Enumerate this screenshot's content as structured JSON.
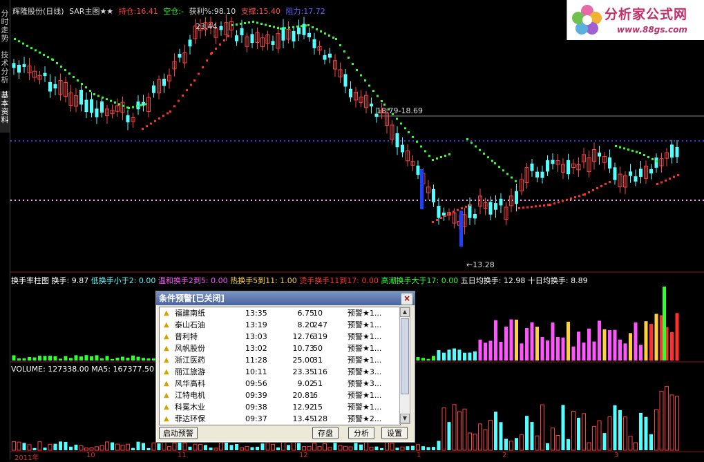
{
  "side_tabs": [
    "分时走势",
    "技术分析",
    "基本资料"
  ],
  "header": {
    "stock": "辉隆股份(日线)",
    "indicator": "SAR主图★★",
    "hold_label": "持仓:",
    "hold_val": "16.41",
    "empty_label": "空仓:",
    "empty_val": "-",
    "profit_label": "获利%:",
    "profit_val": "98.10",
    "support_label": "支撑:",
    "support_val": "15.40",
    "resist_label": "阻力:",
    "resist_val": "17.72"
  },
  "annotations": {
    "high": "23.44",
    "range": "18.79-18.69",
    "low": "←13.28"
  },
  "turnover_header": {
    "name": "换手率柱图",
    "hs": "换手: 9.87",
    "low": "低换手小于2: 0.00",
    "mild": "温和换手2到5: 0.00",
    "hot": "热换手5到11: 1.00",
    "frenzy": "烫手换手11到17: 0.00",
    "high": "高潮换手大于17: 0.00",
    "ma5": "五日均换手: 12.98",
    "ma10": "十日均换手: 8.89"
  },
  "volume_header": "VOLUME: 127338.00  MA5: 167377.50",
  "dates": [
    "2011年",
    "10",
    "11",
    "12",
    "1",
    "2",
    "3"
  ],
  "logo": {
    "title": "分析家公式网",
    "url": "www.88gs.com"
  },
  "dialog": {
    "title": "条件预警[已关闭]",
    "rows": [
      {
        "name": "福建南纸",
        "time": "13:35",
        "price": "6.75",
        "qty": "10",
        "status": "预警★1..."
      },
      {
        "name": "泰山石油",
        "time": "13:19",
        "price": "8.20",
        "qty": "247",
        "status": "预警★1..."
      },
      {
        "name": "普利特",
        "time": "13:03",
        "price": "12.76",
        "qty": "319",
        "status": "预警★1..."
      },
      {
        "name": "风帆股份",
        "time": "13:02",
        "price": "10.73",
        "qty": "50",
        "status": "预警★1..."
      },
      {
        "name": "浙江医药",
        "time": "11:28",
        "price": "25.00",
        "qty": "31",
        "status": "预警★1..."
      },
      {
        "name": "丽江旅游",
        "time": "10:11",
        "price": "23.35",
        "qty": "116",
        "status": "预警★3..."
      },
      {
        "name": "风华高科",
        "time": "09:56",
        "price": "9.02",
        "qty": "51",
        "status": "预警★3..."
      },
      {
        "name": "江特电机",
        "time": "09:39",
        "price": "20.81",
        "qty": "6",
        "status": "预警★1..."
      },
      {
        "name": "科冕木业",
        "time": "09:38",
        "price": "12.92",
        "qty": "15",
        "status": "预警★1..."
      },
      {
        "name": "菲达环保",
        "time": "09:37",
        "price": "13.45",
        "qty": "128",
        "status": "预警★2..."
      }
    ],
    "buttons": {
      "start": "启动预警",
      "save": "存盘",
      "analyze": "分析",
      "settings": "设置"
    }
  },
  "colors": {
    "up": "#ff4040",
    "down": "#54ffff",
    "sar_up": "#ff3030",
    "sar_down": "#30ff30",
    "hold": "#ff4040",
    "support": "#ff5050",
    "resist": "#5050ff"
  }
}
